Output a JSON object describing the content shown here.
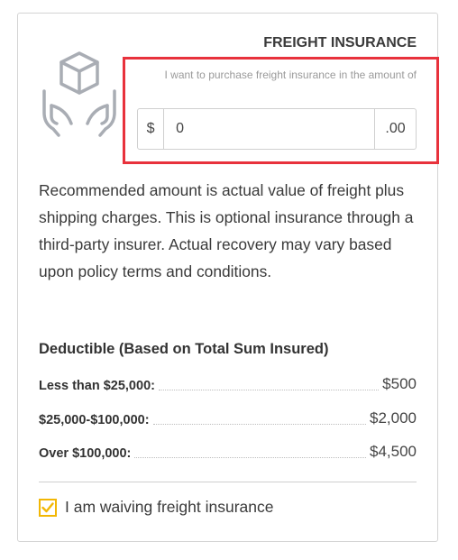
{
  "header": {
    "title": "FREIGHT INSURANCE"
  },
  "icons": {
    "package": "package-hands-icon",
    "check": "check-icon"
  },
  "purchase": {
    "hint": "I want to purchase freight insurance in the amount of",
    "currency_symbol": "$",
    "value": "0",
    "cents": ".00"
  },
  "description": "Recommended amount is actual value of freight plus shipping charges. This is optional insurance through a third-party insurer. Actual recovery may vary based upon policy terms and conditions.",
  "deductible": {
    "title": "Deductible (Based on Total Sum Insured)",
    "rows": [
      {
        "label": "Less than $25,000:",
        "value": "$500"
      },
      {
        "label": "$25,000-$100,000:",
        "value": "$2,000"
      },
      {
        "label": "Over $100,000:",
        "value": "$4,500"
      }
    ]
  },
  "waive": {
    "label": "I am waiving freight insurance",
    "checked": true
  },
  "colors": {
    "highlight": "#e8323c",
    "checkbox": "#f2b705",
    "icon": "#a9adb4"
  }
}
